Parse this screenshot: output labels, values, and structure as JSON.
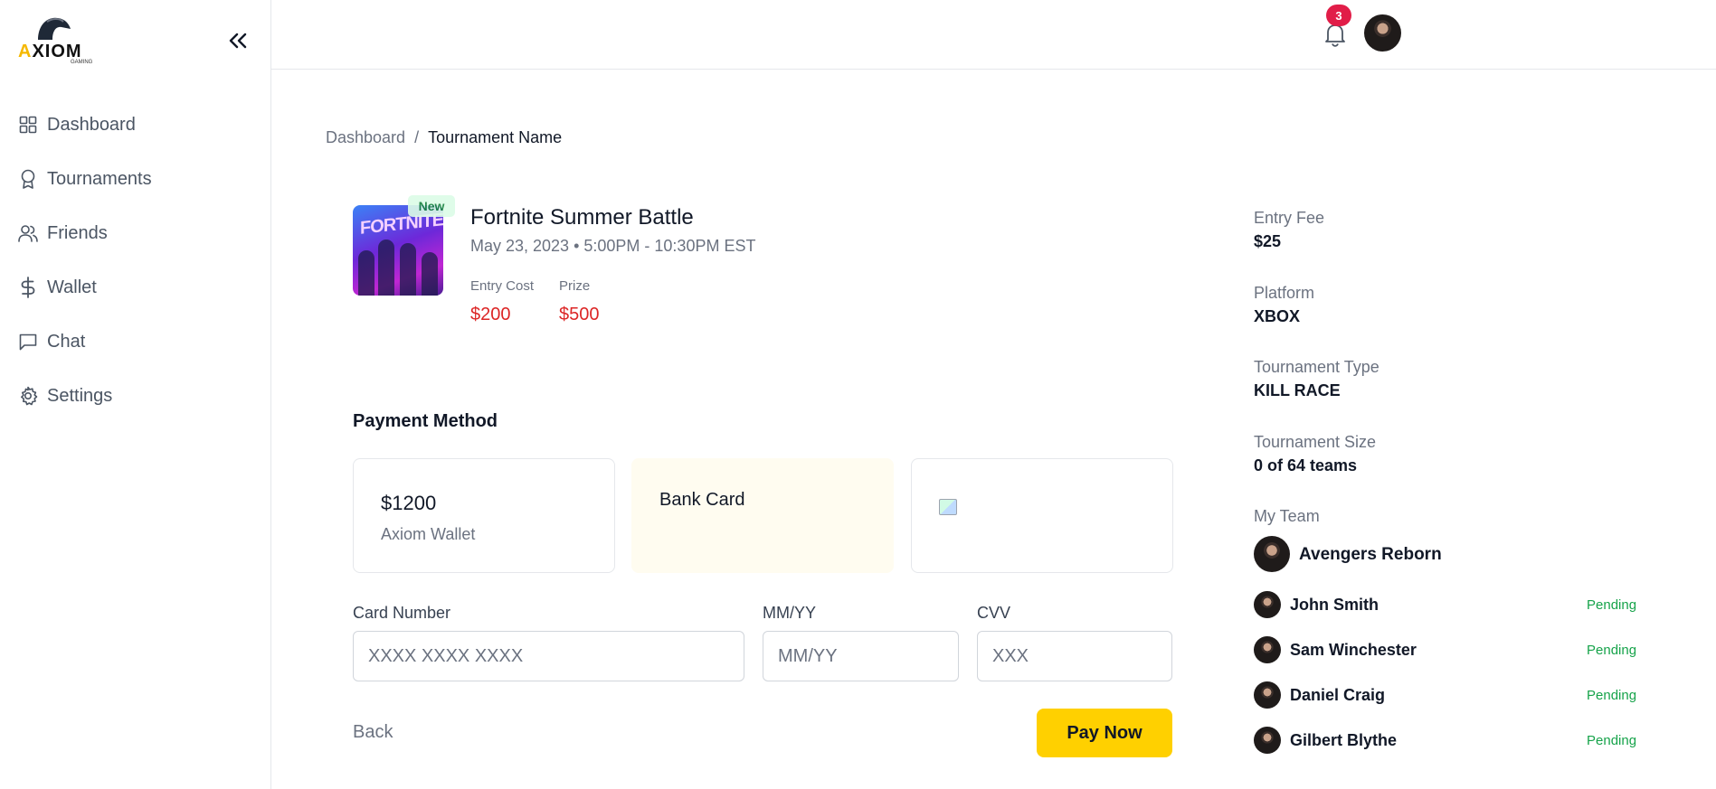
{
  "brand": {
    "logo_text_a": "A",
    "logo_text_rest": "XIOM",
    "logo_sub": "GAMING"
  },
  "sidebar": {
    "items": [
      {
        "label": "Dashboard",
        "icon": "grid-icon"
      },
      {
        "label": "Tournaments",
        "icon": "award-icon"
      },
      {
        "label": "Friends",
        "icon": "users-icon"
      },
      {
        "label": "Wallet",
        "icon": "dollar-icon"
      },
      {
        "label": "Chat",
        "icon": "chat-icon"
      },
      {
        "label": "Settings",
        "icon": "gear-icon"
      }
    ]
  },
  "header": {
    "notification_count": "3"
  },
  "breadcrumb": {
    "root": "Dashboard",
    "separator": "/",
    "current": "Tournament Name"
  },
  "tournament": {
    "badge": "New",
    "thumb_text": "FORTNITE",
    "title": "Fortnite Summer Battle",
    "date": "May 23, 2023 • 5:00PM - 10:30PM EST",
    "entry_cost_label": "Entry Cost",
    "entry_cost": "$200",
    "prize_label": "Prize",
    "prize": "$500"
  },
  "payment": {
    "title": "Payment Method",
    "wallet_amount": "$1200",
    "wallet_label": "Axiom Wallet",
    "bank_card_label": "Bank Card",
    "card_number_label": "Card Number",
    "card_number_placeholder": "XXXX XXXX XXXX",
    "expiry_label": "MM/YY",
    "expiry_placeholder": "MM/YY",
    "cvv_label": "CVV",
    "cvv_placeholder": "XXX",
    "back_label": "Back",
    "pay_label": "Pay Now"
  },
  "details": {
    "entry_fee_label": "Entry Fee",
    "entry_fee": "$25",
    "platform_label": "Platform",
    "platform": "XBOX",
    "type_label": "Tournament Type",
    "type": "KILL RACE",
    "size_label": "Tournament Size",
    "size": "0 of 64 teams",
    "my_team_label": "My Team",
    "team_name": "Avengers Reborn",
    "members": [
      {
        "name": "John Smith",
        "status": "Pending"
      },
      {
        "name": "Sam Winchester",
        "status": "Pending"
      },
      {
        "name": "Daniel Craig",
        "status": "Pending"
      },
      {
        "name": "Gilbert Blythe",
        "status": "Pending"
      }
    ]
  },
  "colors": {
    "accent": "#ffd000",
    "price": "#dc2626",
    "pending": "#16a34a",
    "badge": "#e11d48"
  }
}
